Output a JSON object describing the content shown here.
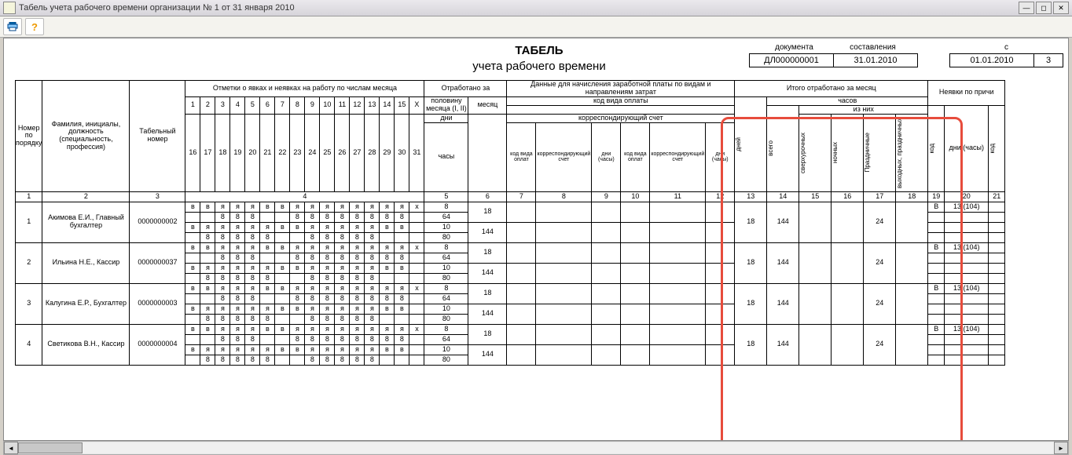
{
  "window": {
    "title": "Табель учета рабочего времени организации № 1 от 31 января 2010"
  },
  "title": {
    "line1": "ТАБЕЛЬ",
    "line2": "учета  рабочего времени"
  },
  "meta": {
    "doc_hdr": "документа",
    "comp_hdr": "составления",
    "doc_no": "ДЛ000000001",
    "comp_date": "31.01.2010",
    "period_hdr": "с",
    "period_from": "01.01.2010",
    "period_to": "3"
  },
  "head": {
    "col1": "Номер по порядку",
    "col2": "Фамилия, инициалы, должность (специальность, профессия)",
    "col3": "Табельный номер",
    "marks": "Отметки о явках и неявках на работу по числам месяца",
    "worked": "Отработано за",
    "half": "половину месяца (I, II)",
    "month": "месяц",
    "days_lbl": "дни",
    "hours_lbl": "часы",
    "pay": "Данные для начисления заработной платы по видам и направлениям затрат",
    "pay_code": "код вида оплаты",
    "corr": "корреспондирующий счет",
    "kod": "код вида оплат",
    "korr": "корреспондирующий счет",
    "dni_ch": "дни (часы)",
    "totals": "Итого отработано за месяц",
    "t_days": "дней",
    "t_hours": "часов",
    "of_which": "из них",
    "over": "сверхурочных",
    "night": "ночных",
    "holi": "Праздничные",
    "week": "выходных, праздничных",
    "abs": "Неявки по причи",
    "abs_kod": "код",
    "abs_dni": "дни (часы)",
    "abs_kod2": "код",
    "days1": [
      "1",
      "2",
      "3",
      "4",
      "5",
      "6",
      "7",
      "8",
      "9",
      "10",
      "11",
      "12",
      "13",
      "14",
      "15",
      "X"
    ],
    "days2": [
      "16",
      "17",
      "18",
      "19",
      "20",
      "21",
      "22",
      "23",
      "24",
      "25",
      "26",
      "27",
      "28",
      "29",
      "30",
      "31"
    ],
    "nums": [
      "1",
      "2",
      "3",
      "4",
      "5",
      "6",
      "7",
      "8",
      "9",
      "10",
      "11",
      "12",
      "13",
      "14",
      "15",
      "16",
      "17",
      "18",
      "19",
      "20",
      "21"
    ]
  },
  "rows": [
    {
      "n": "1",
      "name": "Акимова Е.И., Главный бухгалтер",
      "tab": "0000000002",
      "m1": [
        "в",
        "в",
        "я",
        "я",
        "я",
        "в",
        "в",
        "я",
        "я",
        "я",
        "я",
        "я",
        "я",
        "я",
        "я",
        "х"
      ],
      "h1": [
        "",
        "",
        "8",
        "8",
        "8",
        "",
        "",
        "8",
        "8",
        "8",
        "8",
        "8",
        "8",
        "8",
        "8",
        ""
      ],
      "m2": [
        "в",
        "я",
        "я",
        "я",
        "я",
        "я",
        "в",
        "в",
        "я",
        "я",
        "я",
        "я",
        "я",
        "в",
        "в",
        ""
      ],
      "h2": [
        "",
        "8",
        "8",
        "8",
        "8",
        "8",
        "",
        "",
        "8",
        "8",
        "8",
        "8",
        "8",
        "",
        "",
        ""
      ],
      "half_d": "8",
      "half_h": "64",
      "half_d2": "10",
      "half_h2": "80",
      "mon_d": "18",
      "mon_h": "144",
      "t_days": "18",
      "t_hrs": "144",
      "holi": "24",
      "abs_k": "В",
      "abs_v": "13 (104)"
    },
    {
      "n": "2",
      "name": "Ильина Н.Е., Кассир",
      "tab": "0000000037",
      "m1": [
        "в",
        "в",
        "я",
        "я",
        "я",
        "в",
        "в",
        "я",
        "я",
        "я",
        "я",
        "я",
        "я",
        "я",
        "я",
        "х"
      ],
      "h1": [
        "",
        "",
        "8",
        "8",
        "8",
        "",
        "",
        "8",
        "8",
        "8",
        "8",
        "8",
        "8",
        "8",
        "8",
        ""
      ],
      "m2": [
        "в",
        "я",
        "я",
        "я",
        "я",
        "я",
        "в",
        "в",
        "я",
        "я",
        "я",
        "я",
        "я",
        "в",
        "в",
        ""
      ],
      "h2": [
        "",
        "8",
        "8",
        "8",
        "8",
        "8",
        "",
        "",
        "8",
        "8",
        "8",
        "8",
        "8",
        "",
        "",
        ""
      ],
      "half_d": "8",
      "half_h": "64",
      "half_d2": "10",
      "half_h2": "80",
      "mon_d": "18",
      "mon_h": "144",
      "t_days": "18",
      "t_hrs": "144",
      "holi": "24",
      "abs_k": "В",
      "abs_v": "13 (104)"
    },
    {
      "n": "3",
      "name": "Калугина Е.Р., Бухгалтер",
      "tab": "0000000003",
      "m1": [
        "в",
        "в",
        "я",
        "я",
        "я",
        "в",
        "в",
        "я",
        "я",
        "я",
        "я",
        "я",
        "я",
        "я",
        "я",
        "х"
      ],
      "h1": [
        "",
        "",
        "8",
        "8",
        "8",
        "",
        "",
        "8",
        "8",
        "8",
        "8",
        "8",
        "8",
        "8",
        "8",
        ""
      ],
      "m2": [
        "в",
        "я",
        "я",
        "я",
        "я",
        "я",
        "в",
        "в",
        "я",
        "я",
        "я",
        "я",
        "я",
        "в",
        "в",
        ""
      ],
      "h2": [
        "",
        "8",
        "8",
        "8",
        "8",
        "8",
        "",
        "",
        "8",
        "8",
        "8",
        "8",
        "8",
        "",
        "",
        ""
      ],
      "half_d": "8",
      "half_h": "64",
      "half_d2": "10",
      "half_h2": "80",
      "mon_d": "18",
      "mon_h": "144",
      "t_days": "18",
      "t_hrs": "144",
      "holi": "24",
      "abs_k": "В",
      "abs_v": "13 (104)"
    },
    {
      "n": "4",
      "name": "Светикова В.Н., Кассир",
      "tab": "0000000004",
      "m1": [
        "в",
        "в",
        "я",
        "я",
        "я",
        "в",
        "в",
        "я",
        "я",
        "я",
        "я",
        "я",
        "я",
        "я",
        "я",
        "х"
      ],
      "h1": [
        "",
        "",
        "8",
        "8",
        "8",
        "",
        "",
        "8",
        "8",
        "8",
        "8",
        "8",
        "8",
        "8",
        "8",
        ""
      ],
      "m2": [
        "в",
        "я",
        "я",
        "я",
        "я",
        "я",
        "в",
        "в",
        "я",
        "я",
        "я",
        "я",
        "я",
        "в",
        "в",
        ""
      ],
      "h2": [
        "",
        "8",
        "8",
        "8",
        "8",
        "8",
        "",
        "",
        "8",
        "8",
        "8",
        "8",
        "8",
        "",
        "",
        ""
      ],
      "half_d": "8",
      "half_h": "64",
      "half_d2": "10",
      "half_h2": "80",
      "mon_d": "18",
      "mon_h": "144",
      "t_days": "18",
      "t_hrs": "144",
      "holi": "24",
      "abs_k": "В",
      "abs_v": "13 (104)"
    }
  ]
}
